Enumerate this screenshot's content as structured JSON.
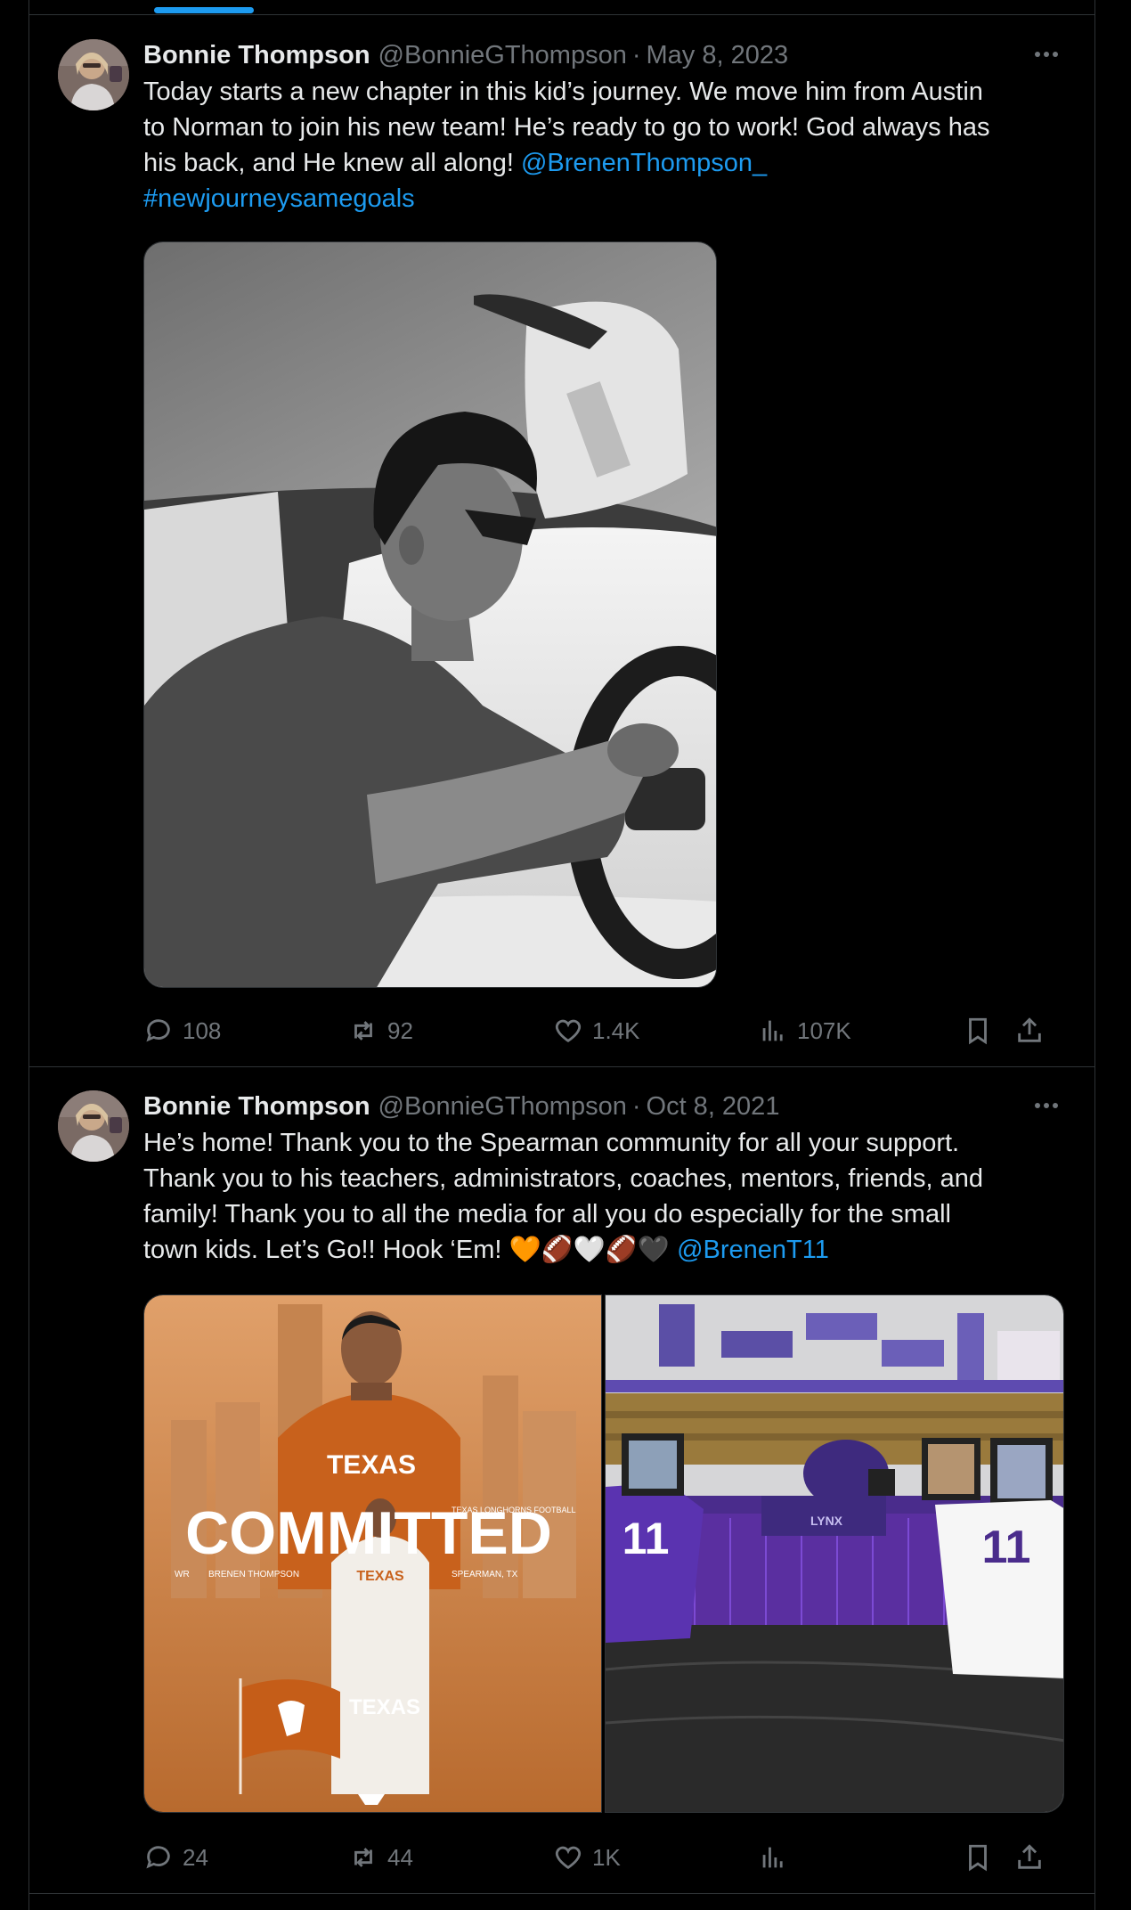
{
  "tweets": [
    {
      "author_name": "Bonnie Thompson",
      "handle": "@BonnieGThompson",
      "separator": "·",
      "date": "May 8, 2023",
      "text_lines": [
        "Today starts a new chapter in this kid’s journey. We move him from Austin",
        "to Norman to join his new team! He’s ready to go to work! God always has",
        "his back, and He knew all along! "
      ],
      "mention": "@BrenenThompson_",
      "hashtag": "#newjourneysamegoals",
      "replies": "108",
      "reposts": "92",
      "likes": "1.4K",
      "views": "107K"
    },
    {
      "author_name": "Bonnie Thompson",
      "handle": "@BonnieGThompson",
      "separator": "·",
      "date": "Oct 8, 2021",
      "text_lines": [
        "He’s home! Thank you to the Spearman community for all your support.",
        "Thank you to his teachers, administrators, coaches, mentors, friends, and",
        "family! Thank you to all the media for all you do especially for the small",
        "town kids. Let’s Go!! Hook ‘Em! "
      ],
      "emoji": "🧡🏈🤍🏈🖤",
      "mention": "@BrenenT11",
      "graphic_left": {
        "headline": "COMMITTED",
        "position": "WR",
        "player": "BRENEN THOMPSON",
        "program": "TEXAS LONGHORNS FOOTBALL",
        "hometown": "SPEARMAN, TX",
        "jersey_text": "TEXAS",
        "flag_text": "TEXAS"
      },
      "graphic_right": {
        "helmet_text": "LYNX",
        "jersey_number": "11"
      },
      "replies": "24",
      "reposts": "44",
      "likes": "1K",
      "views": ""
    }
  ],
  "icons": {
    "reply": "speech-bubble-icon",
    "repost": "repost-arrows-icon",
    "like": "heart-icon",
    "views": "bar-chart-icon",
    "bookmark": "bookmark-icon",
    "share": "share-upload-icon",
    "more": "more-dots-icon"
  },
  "colors": {
    "background": "#000000",
    "text": "#e7e9ea",
    "secondary": "#71767b",
    "link": "#1d9bf0",
    "border": "#2f3336"
  }
}
